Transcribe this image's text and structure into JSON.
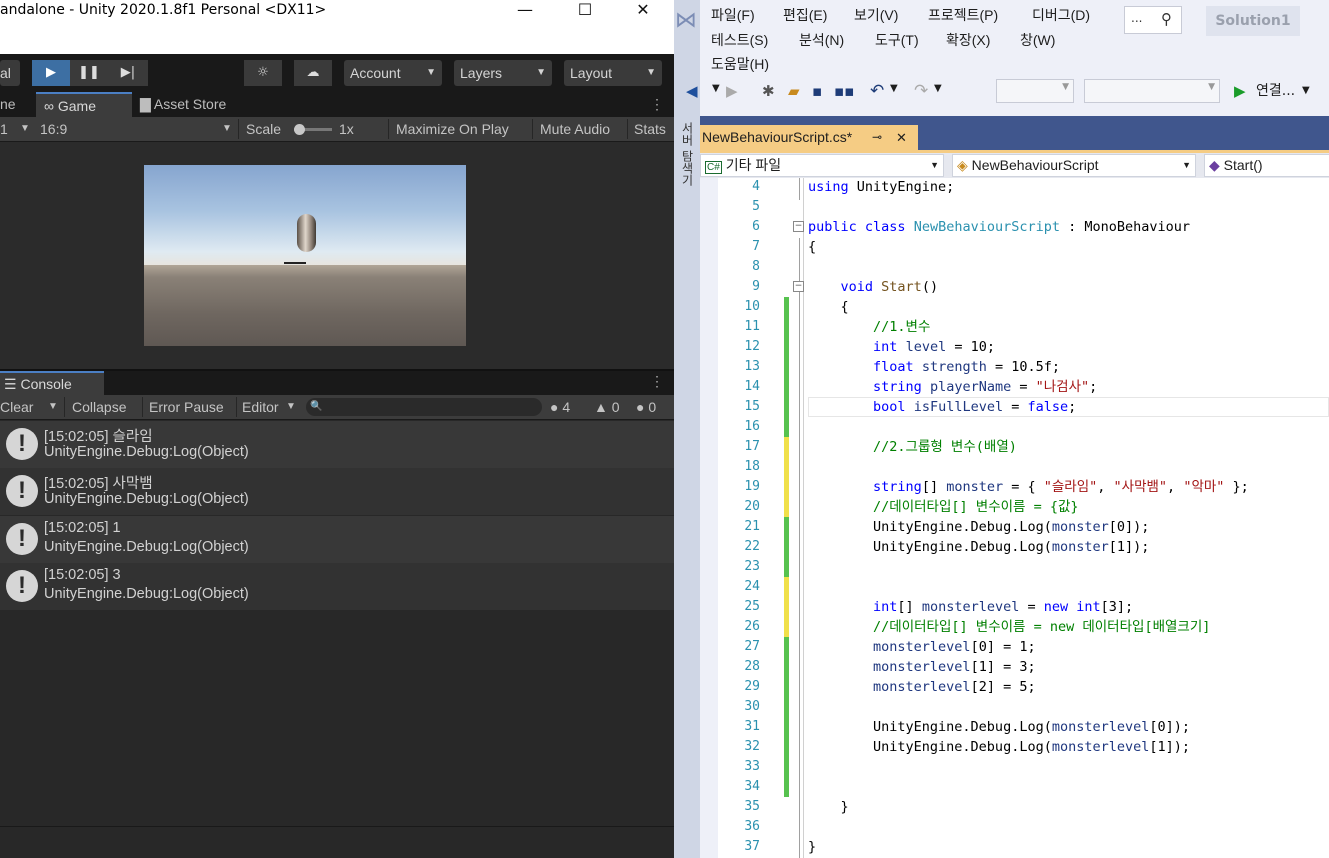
{
  "unity": {
    "title": "andalone - Unity 2020.1.8f1 Personal <DX11>",
    "window_buttons": {
      "min": "—",
      "max": "☐",
      "close": "✕"
    },
    "toolbar": {
      "left_label": "al",
      "account": "Account",
      "layers": "Layers",
      "layout": "Layout"
    },
    "tabs": {
      "scene_partial": "ne",
      "game": "Game",
      "asset_store": "Asset Store"
    },
    "game_bar": {
      "display": "1",
      "aspect": "16:9",
      "scale_label": "Scale",
      "scale_value": "1x",
      "maximize": "Maximize On Play",
      "mute": "Mute Audio",
      "stats": "Stats"
    },
    "console": {
      "tab": "Console",
      "clear": "Clear",
      "collapse": "Collapse",
      "error_pause": "Error Pause",
      "editor": "Editor",
      "counts": {
        "log": "4",
        "warn": "0",
        "error": "0"
      },
      "entries": [
        {
          "time": "[15:02:05] 슬라임",
          "source": "UnityEngine.Debug:Log(Object)"
        },
        {
          "time": "[15:02:05] 사막뱀",
          "source": "UnityEngine.Debug:Log(Object)"
        },
        {
          "time": "[15:02:05] 1",
          "source": "UnityEngine.Debug:Log(Object)"
        },
        {
          "time": "[15:02:05] 3",
          "source": "UnityEngine.Debug:Log(Object)"
        }
      ]
    }
  },
  "vs": {
    "menu": [
      "파일(F)",
      "편집(E)",
      "보기(V)",
      "프로젝트(P)",
      "디버그(D)",
      "테스트(S)",
      "분석(N)",
      "도구(T)",
      "확장(X)",
      "창(W)",
      "도움말(H)"
    ],
    "search_placeholder": "...",
    "solution": "Solution1",
    "connect": "연결...",
    "side_label": "서버 탐색기",
    "doc_tab": "NewBehaviourScript.cs*",
    "nav": {
      "project": "기타 파일",
      "class": "NewBehaviourScript",
      "member": "Start()"
    },
    "code_lines": [
      {
        "n": "4",
        "t": "using UnityEngine;"
      },
      {
        "n": "5",
        "t": ""
      },
      {
        "n": "6",
        "t": "public class NewBehaviourScript : MonoBehaviour"
      },
      {
        "n": "7",
        "t": "{"
      },
      {
        "n": "8",
        "t": ""
      },
      {
        "n": "9",
        "t": "    void Start()"
      },
      {
        "n": "10",
        "t": "    {"
      },
      {
        "n": "11",
        "t": "        //1.변수"
      },
      {
        "n": "12",
        "t": "        int level = 10;"
      },
      {
        "n": "13",
        "t": "        float strength = 10.5f;"
      },
      {
        "n": "14",
        "t": "        string playerName = \"나검사\";"
      },
      {
        "n": "15",
        "t": "        bool isFullLevel = false;"
      },
      {
        "n": "16",
        "t": ""
      },
      {
        "n": "17",
        "t": "        //2.그룹형 변수(배열)"
      },
      {
        "n": "18",
        "t": ""
      },
      {
        "n": "19",
        "t": "        string[] monster = { \"슬라임\", \"사막뱀\", \"악마\" };"
      },
      {
        "n": "20",
        "t": "        //데이터타입[] 변수이름 = {값}"
      },
      {
        "n": "21",
        "t": "        UnityEngine.Debug.Log(monster[0]);"
      },
      {
        "n": "22",
        "t": "        UnityEngine.Debug.Log(monster[1]);"
      },
      {
        "n": "23",
        "t": ""
      },
      {
        "n": "24",
        "t": ""
      },
      {
        "n": "25",
        "t": "        int[] monsterlevel = new int[3];"
      },
      {
        "n": "26",
        "t": "        //데이터타입[] 변수이름 = new 데이터타입[배열크기]"
      },
      {
        "n": "27",
        "t": "        monsterlevel[0] = 1;"
      },
      {
        "n": "28",
        "t": "        monsterlevel[1] = 3;"
      },
      {
        "n": "29",
        "t": "        monsterlevel[2] = 5;"
      },
      {
        "n": "30",
        "t": ""
      },
      {
        "n": "31",
        "t": "        UnityEngine.Debug.Log(monsterlevel[0]);"
      },
      {
        "n": "32",
        "t": "        UnityEngine.Debug.Log(monsterlevel[1]);"
      },
      {
        "n": "33",
        "t": ""
      },
      {
        "n": "34",
        "t": ""
      },
      {
        "n": "35",
        "t": "    }"
      },
      {
        "n": "36",
        "t": ""
      },
      {
        "n": "37",
        "t": "}"
      }
    ]
  }
}
